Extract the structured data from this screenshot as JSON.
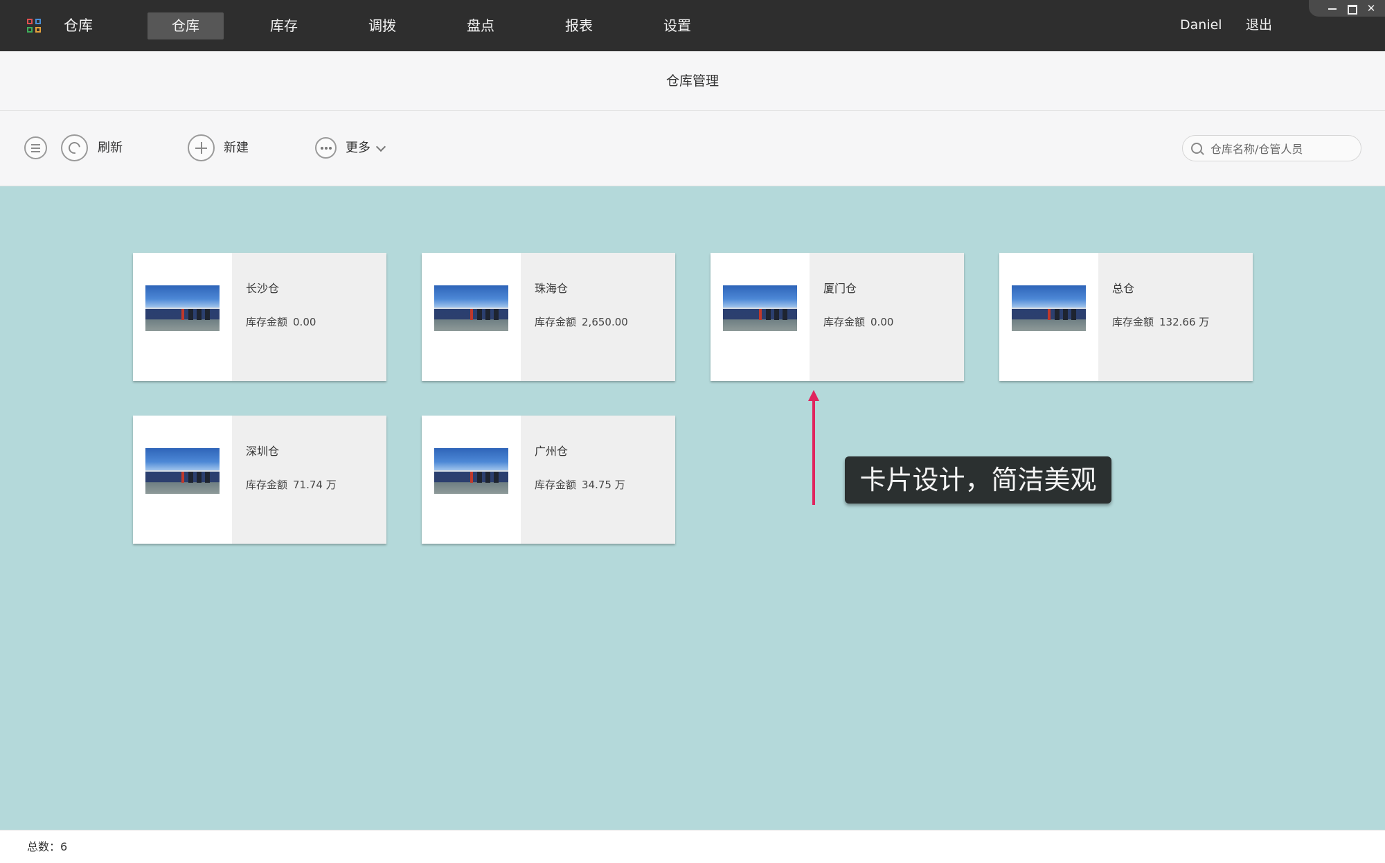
{
  "topbar": {
    "app_title": "仓库",
    "nav": [
      {
        "label": "仓库",
        "active": true
      },
      {
        "label": "库存",
        "active": false
      },
      {
        "label": "调拨",
        "active": false
      },
      {
        "label": "盘点",
        "active": false
      },
      {
        "label": "报表",
        "active": false
      },
      {
        "label": "设置",
        "active": false
      }
    ],
    "user_name": "Daniel",
    "logout_label": "退出"
  },
  "page": {
    "title": "仓库管理"
  },
  "toolbar": {
    "refresh_label": "刷新",
    "new_label": "新建",
    "more_label": "更多",
    "search_placeholder": "仓库名称/仓管人员"
  },
  "warehouses": [
    {
      "name": "长沙仓",
      "amount_label": "库存金额",
      "amount": "0.00"
    },
    {
      "name": "珠海仓",
      "amount_label": "库存金额",
      "amount": "2,650.00"
    },
    {
      "name": "厦门仓",
      "amount_label": "库存金额",
      "amount": "0.00"
    },
    {
      "name": "总仓",
      "amount_label": "库存金额",
      "amount": "132.66 万"
    },
    {
      "name": "深圳仓",
      "amount_label": "库存金额",
      "amount": "71.74 万"
    },
    {
      "name": "广州仓",
      "amount_label": "库存金额",
      "amount": "34.75 万"
    }
  ],
  "callout": {
    "text": "卡片设计，简洁美观"
  },
  "status": {
    "total_label": "总数：6"
  },
  "colors": {
    "topbar": "#2e2e2e",
    "main_background": "#b4d9da",
    "arrow": "#e0245e",
    "card": "#efefef"
  },
  "icons": {
    "app_logo": "grid-icon",
    "menu": "menu-icon",
    "refresh": "refresh-icon",
    "new": "plus-icon",
    "more": "more-icon",
    "search": "search-icon"
  }
}
